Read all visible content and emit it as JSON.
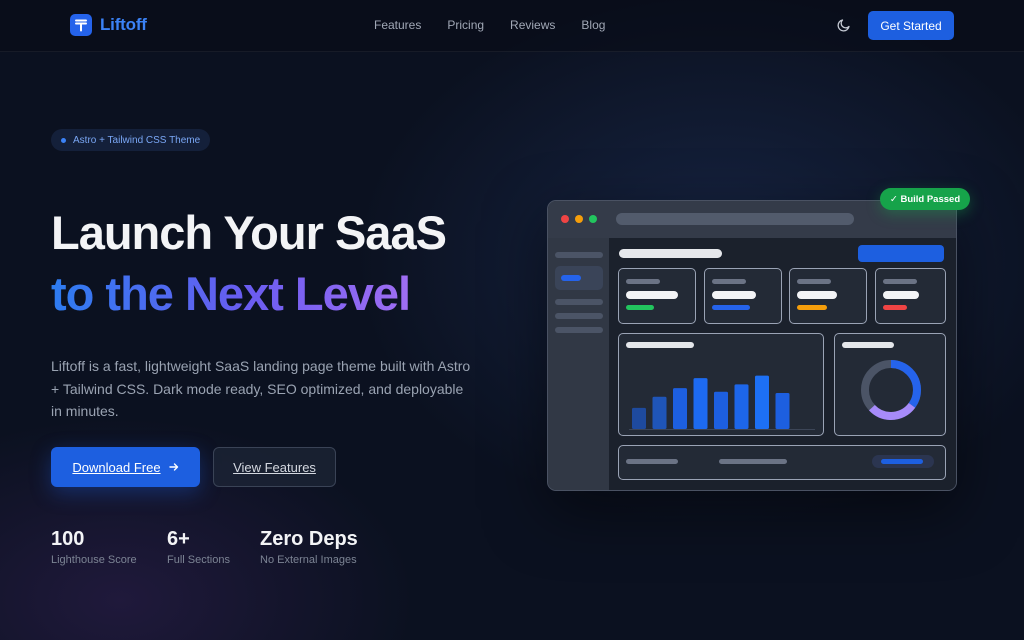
{
  "nav": {
    "brand": "Liftoff",
    "links": [
      "Features",
      "Pricing",
      "Reviews",
      "Blog"
    ],
    "theme_icon": "moon-icon",
    "cta": "Get Started"
  },
  "hero": {
    "pill": "Astro + Tailwind CSS Theme",
    "title_line1": "Launch Your SaaS",
    "title_line2": "to the Next Level",
    "description": "Liftoff is a fast, lightweight SaaS landing page theme built with Astro + Tailwind CSS. Dark mode ready, SEO optimized, and deployable in minutes.",
    "primary_button": "Download Free",
    "primary_button_icon": "arrow-right-icon",
    "secondary_button": "View Features"
  },
  "stats": [
    {
      "value": "100",
      "label": "Lighthouse Score"
    },
    {
      "value": "6+",
      "label": "Full Sections"
    },
    {
      "value": "Zero Deps",
      "label": "No External Images"
    }
  ],
  "mockup": {
    "badge": "✓ Build Passed",
    "bar_values": [
      0.34,
      0.52,
      0.66,
      0.82,
      0.6,
      0.72,
      0.86,
      0.58
    ],
    "donut_blue_fraction": 0.35,
    "donut_purple_fraction": 0.28,
    "colors": {
      "accent": "#1d5fe0",
      "green": "#22c55e",
      "blue": "#2563eb",
      "orange": "#f59e0b",
      "red": "#ef4444",
      "purple": "#a78bfa"
    }
  }
}
